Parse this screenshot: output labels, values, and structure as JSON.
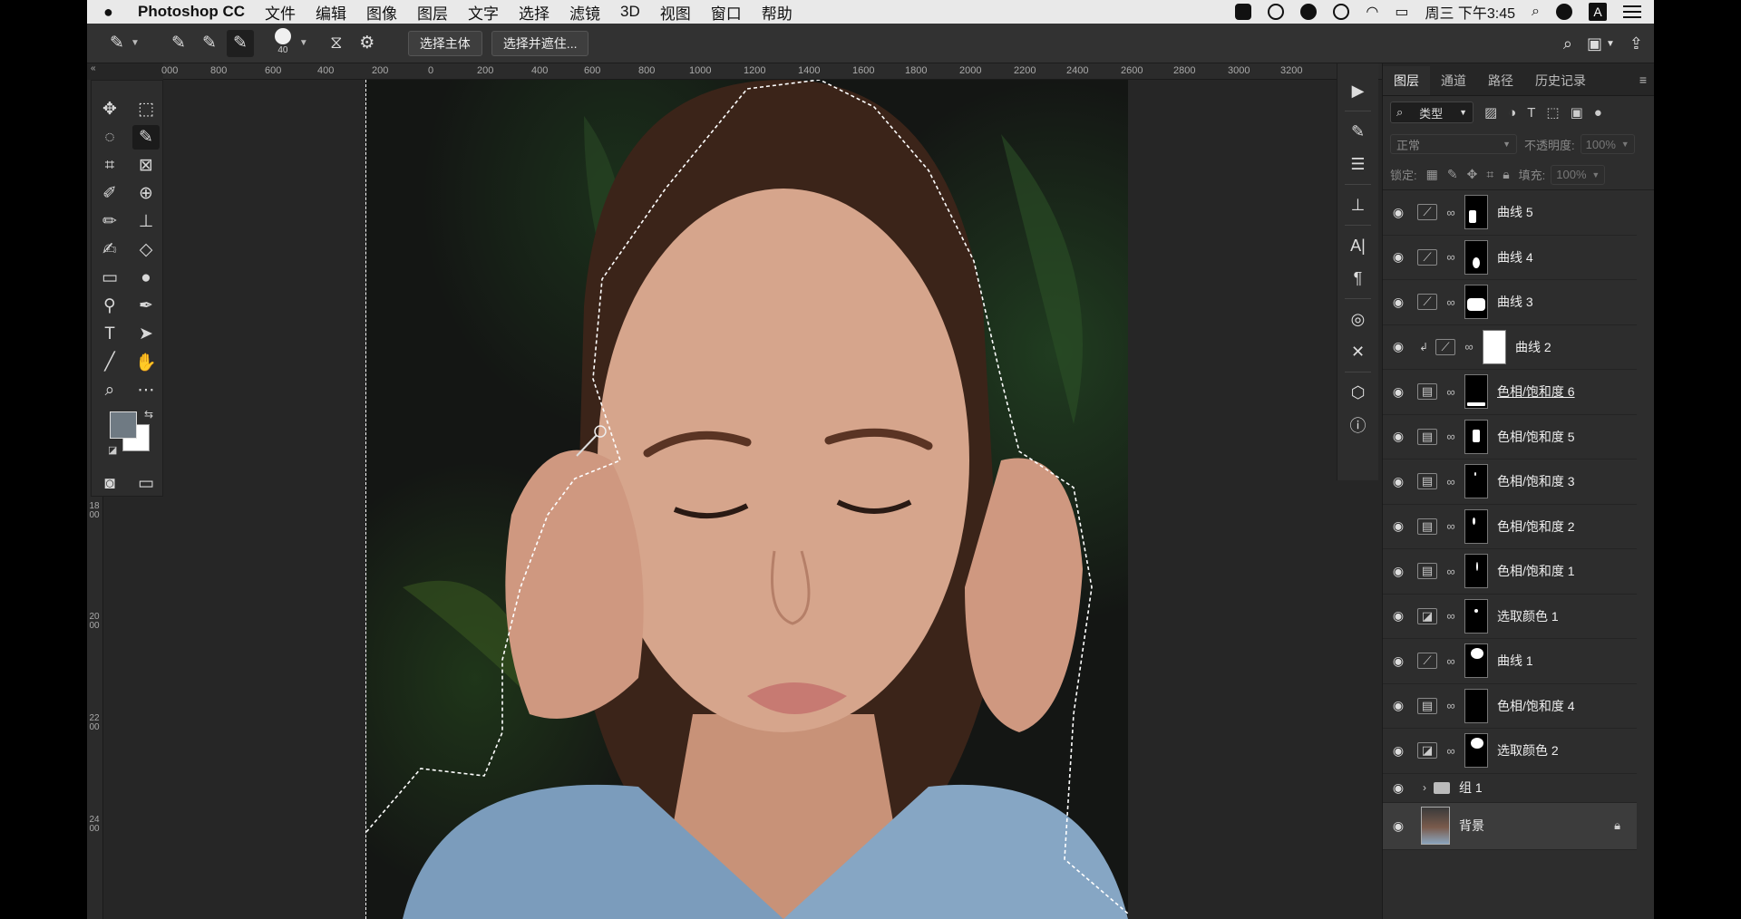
{
  "menubar": {
    "app": "Photoshop CC",
    "items": [
      "文件",
      "编辑",
      "图像",
      "图层",
      "文字",
      "选择",
      "滤镜",
      "3D",
      "视图",
      "窗口",
      "帮助"
    ],
    "clock": "周三 下午3:45",
    "input_method": "A"
  },
  "options": {
    "brush_size": "40",
    "select_subject": "选择主体",
    "select_mask": "选择并遮住..."
  },
  "ruler": {
    "top_ticks": [
      "000",
      "800",
      "600",
      "400",
      "200",
      "0",
      "200",
      "400",
      "600",
      "800",
      "1000",
      "1200",
      "1400",
      "1600",
      "1800",
      "2000",
      "2200",
      "2400",
      "2600",
      "2800",
      "3000",
      "3200"
    ],
    "left_labels": [
      "1800",
      "2000",
      "2200",
      "2400"
    ]
  },
  "colors": {
    "foreground": "#6f7a83",
    "background": "#ffffff"
  },
  "layers_panel": {
    "tabs": [
      "图层",
      "通道",
      "路径",
      "历史记录"
    ],
    "filter": "类型",
    "blend_mode": "正常",
    "opacity_label": "不透明度:",
    "opacity": "100%",
    "lock_label": "锁定:",
    "fill_label": "填充:",
    "fill": "100%",
    "layers": [
      {
        "name": "曲线 5",
        "type": "curves"
      },
      {
        "name": "曲线 4",
        "type": "curves"
      },
      {
        "name": "曲线 3",
        "type": "curves"
      },
      {
        "name": "曲线 2",
        "type": "curves"
      },
      {
        "name": "色相/饱和度 6",
        "type": "hue"
      },
      {
        "name": "色相/饱和度 5",
        "type": "hue"
      },
      {
        "name": "色相/饱和度 3",
        "type": "hue"
      },
      {
        "name": "色相/饱和度 2",
        "type": "hue"
      },
      {
        "name": "色相/饱和度 1",
        "type": "hue"
      },
      {
        "name": "选取颜色 1",
        "type": "selective"
      },
      {
        "name": "曲线 1",
        "type": "curves"
      },
      {
        "name": "色相/饱和度 4",
        "type": "hue"
      },
      {
        "name": "选取颜色 2",
        "type": "selective"
      }
    ],
    "group": "组 1",
    "background_layer": "背景"
  }
}
